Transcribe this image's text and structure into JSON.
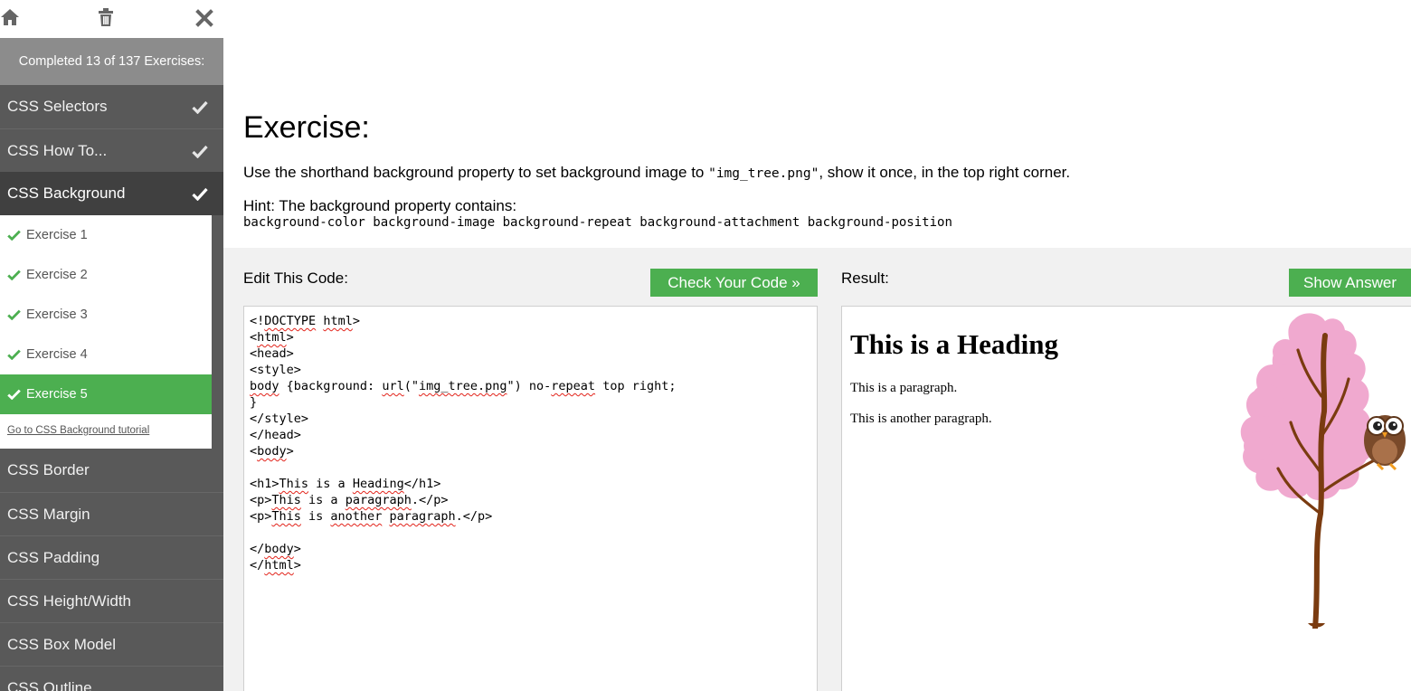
{
  "sidebar": {
    "progress_text": "Completed 13 of 137 Exercises:",
    "topics": [
      {
        "label": "CSS Selectors",
        "done": true
      },
      {
        "label": "CSS How To...",
        "done": true
      },
      {
        "label": "CSS Background",
        "done": true
      },
      {
        "label": "CSS Border",
        "done": false
      },
      {
        "label": "CSS Margin",
        "done": false
      },
      {
        "label": "CSS Padding",
        "done": false
      },
      {
        "label": "CSS Height/Width",
        "done": false
      },
      {
        "label": "CSS Box Model",
        "done": false
      },
      {
        "label": "CSS Outline",
        "done": false
      }
    ],
    "exercises": [
      {
        "label": "Exercise 1"
      },
      {
        "label": "Exercise 2"
      },
      {
        "label": "Exercise 3"
      },
      {
        "label": "Exercise 4"
      },
      {
        "label": "Exercise 5"
      }
    ],
    "tutorial_link": "Go to CSS Background tutorial"
  },
  "exercise": {
    "title": "Exercise:",
    "instruction_before": "Use the shorthand background property to set background image to ",
    "instruction_code": "\"img_tree.png\"",
    "instruction_after": ", show it once, in the top right corner.",
    "hint_label": "Hint: The background property contains:",
    "hint_code": "background-color background-image background-repeat background-attachment background-position"
  },
  "editor": {
    "label": "Edit This Code:",
    "check_button": "Check Your Code »",
    "lines": [
      "<!DOCTYPE html>",
      "<html>",
      "<head>",
      "<style>",
      "body {background: url(\"img_tree.png\") no-repeat top right;",
      "}",
      "</style>",
      "</head>",
      "<body>",
      "",
      "<h1>This is a Heading</h1>",
      "<p>This is a paragraph.</p>",
      "<p>This is another paragraph.</p>",
      "",
      "</body>",
      "</html>"
    ]
  },
  "result": {
    "label": "Result:",
    "answer_button": "Show Answer",
    "heading": "This is a Heading",
    "paragraph1": "This is a paragraph.",
    "paragraph2": "This is another paragraph."
  },
  "colors": {
    "accent_green": "#4caf50",
    "sidebar_bg": "#595959",
    "sidebar_active": "#404040",
    "progress_bg": "#8c8c8c",
    "tree_blossom": "#f0a9cf",
    "tree_trunk": "#7a3b10"
  },
  "icons": [
    "home-icon",
    "trash-icon",
    "close-icon",
    "check-icon"
  ]
}
